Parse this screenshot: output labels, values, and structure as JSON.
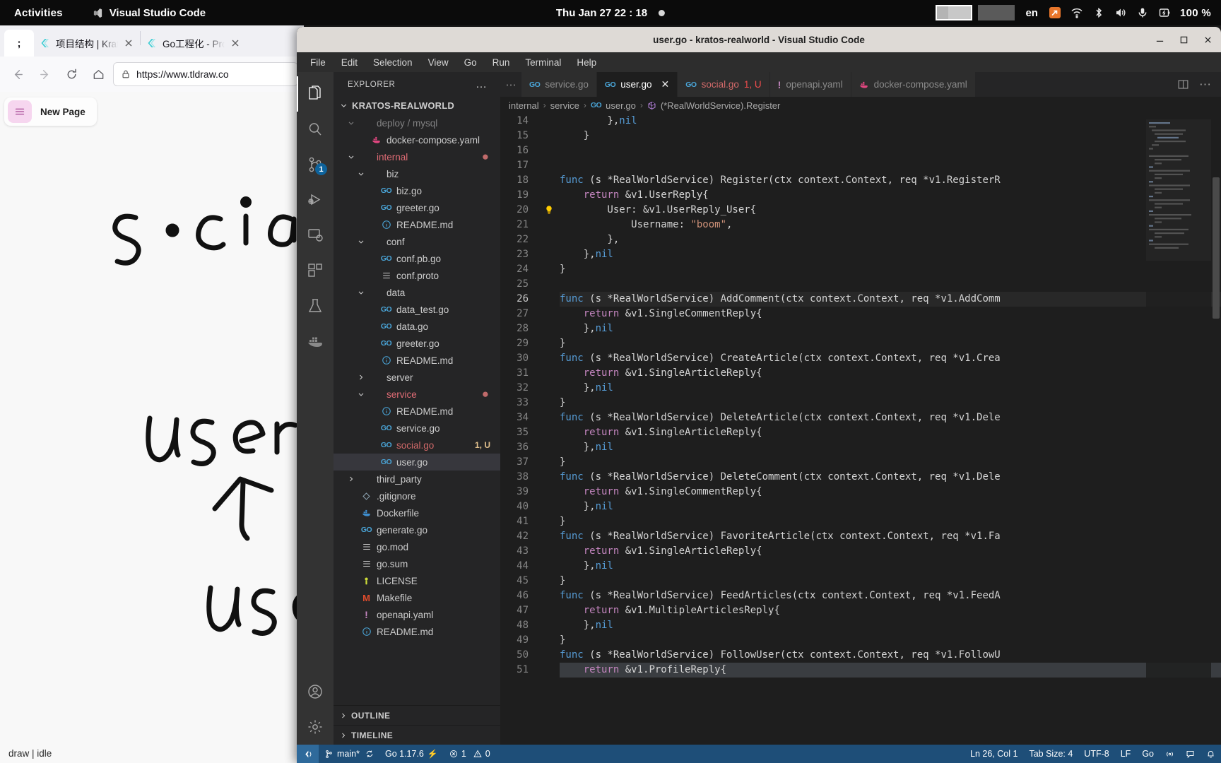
{
  "topbar": {
    "activities": "Activities",
    "app_name": "Visual Studio Code",
    "app_icon": "vscode-icon",
    "clock": "Thu Jan 27  22 : 18",
    "recording_dot": "recording-indicator",
    "language": "en",
    "battery": "100 %",
    "tray_icons": [
      "orange-update-icon",
      "wifi-icon",
      "bluetooth-icon",
      "volume-icon",
      "microphone-icon",
      "battery-icon"
    ]
  },
  "firefox": {
    "pinned_tab_label": ";",
    "tabs": [
      {
        "title": "项目结构 | Krato",
        "favicon": "kratos-icon"
      },
      {
        "title": "Go工程化 - Proje",
        "favicon": "kratos-icon"
      }
    ],
    "nav": {
      "back": "back-arrow",
      "forward": "forward-arrow",
      "reload": "reload-icon",
      "home": "home-icon",
      "lock": "lock-icon",
      "url": "https://www.tldraw.co"
    },
    "tldraw": {
      "menu_icon": "hamburger-menu-icon",
      "page_name": "New Page",
      "sketch_words": [
        "social",
        "user",
        "use"
      ],
      "status": "draw | idle"
    }
  },
  "vscode": {
    "window_title": "user.go - kratos-realworld - Visual Studio Code",
    "window_controls": [
      "minimize",
      "maximize",
      "close"
    ],
    "menus": [
      "File",
      "Edit",
      "Selection",
      "View",
      "Go",
      "Run",
      "Terminal",
      "Help"
    ],
    "activitybar": [
      {
        "name": "explorer",
        "icon": "files-icon",
        "active": true,
        "badge": ""
      },
      {
        "name": "search",
        "icon": "search-icon",
        "active": false,
        "badge": ""
      },
      {
        "name": "source-control",
        "icon": "source-control-icon",
        "active": false,
        "badge": "1"
      },
      {
        "name": "run-and-debug",
        "icon": "debug-icon",
        "active": false,
        "badge": ""
      },
      {
        "name": "remote-explorer",
        "icon": "remote-explorer-icon",
        "active": false,
        "badge": ""
      },
      {
        "name": "extensions",
        "icon": "extensions-icon",
        "active": false,
        "badge": ""
      },
      {
        "name": "testing",
        "icon": "beaker-icon",
        "active": false,
        "badge": ""
      },
      {
        "name": "docker",
        "icon": "docker-icon",
        "active": false,
        "badge": ""
      },
      {
        "name": "accounts",
        "icon": "account-icon",
        "active": false,
        "badge": ""
      },
      {
        "name": "settings",
        "icon": "gear-icon",
        "active": false,
        "badge": ""
      }
    ],
    "explorer": {
      "title": "EXPLORER",
      "more_actions": "…",
      "root": "KRATOS-REALWORLD",
      "tree": [
        {
          "label": "deploy / mysql",
          "indent": 1,
          "kind": "folder",
          "open": true,
          "icon": "",
          "clipped": true
        },
        {
          "label": "docker-compose.yaml",
          "indent": 2,
          "kind": "file",
          "icon": "docker-icon"
        },
        {
          "label": "internal",
          "indent": 1,
          "kind": "folder",
          "open": true,
          "icon": "",
          "color": "mod",
          "dot": "●"
        },
        {
          "label": "biz",
          "indent": 2,
          "kind": "folder",
          "open": true,
          "icon": ""
        },
        {
          "label": "biz.go",
          "indent": 3,
          "kind": "file",
          "icon": "go-icon"
        },
        {
          "label": "greeter.go",
          "indent": 3,
          "kind": "file",
          "icon": "go-icon"
        },
        {
          "label": "README.md",
          "indent": 3,
          "kind": "file",
          "icon": "info-icon"
        },
        {
          "label": "conf",
          "indent": 2,
          "kind": "folder",
          "open": true,
          "icon": ""
        },
        {
          "label": "conf.pb.go",
          "indent": 3,
          "kind": "file",
          "icon": "go-icon"
        },
        {
          "label": "conf.proto",
          "indent": 3,
          "kind": "file",
          "icon": "proto-icon"
        },
        {
          "label": "data",
          "indent": 2,
          "kind": "folder",
          "open": true,
          "icon": ""
        },
        {
          "label": "data_test.go",
          "indent": 3,
          "kind": "file",
          "icon": "go-icon"
        },
        {
          "label": "data.go",
          "indent": 3,
          "kind": "file",
          "icon": "go-icon"
        },
        {
          "label": "greeter.go",
          "indent": 3,
          "kind": "file",
          "icon": "go-icon"
        },
        {
          "label": "README.md",
          "indent": 3,
          "kind": "file",
          "icon": "info-icon"
        },
        {
          "label": "server",
          "indent": 2,
          "kind": "folder",
          "open": false,
          "icon": ""
        },
        {
          "label": "service",
          "indent": 2,
          "kind": "folder",
          "open": true,
          "icon": "",
          "color": "mod",
          "dot": "●"
        },
        {
          "label": "README.md",
          "indent": 3,
          "kind": "file",
          "icon": "info-icon"
        },
        {
          "label": "service.go",
          "indent": 3,
          "kind": "file",
          "icon": "go-icon"
        },
        {
          "label": "social.go",
          "indent": 3,
          "kind": "file",
          "icon": "go-icon",
          "color": "mod2",
          "badge": "1, U"
        },
        {
          "label": "user.go",
          "indent": 3,
          "kind": "file",
          "icon": "go-icon",
          "selected": true
        },
        {
          "label": "third_party",
          "indent": 1,
          "kind": "folder",
          "open": false,
          "icon": ""
        },
        {
          "label": ".gitignore",
          "indent": 1,
          "kind": "file",
          "icon": "git-icon"
        },
        {
          "label": "Dockerfile",
          "indent": 1,
          "kind": "file",
          "icon": "docker-blue-icon"
        },
        {
          "label": "generate.go",
          "indent": 1,
          "kind": "file",
          "icon": "go-icon"
        },
        {
          "label": "go.mod",
          "indent": 1,
          "kind": "file",
          "icon": "proto-icon"
        },
        {
          "label": "go.sum",
          "indent": 1,
          "kind": "file",
          "icon": "proto-icon"
        },
        {
          "label": "LICENSE",
          "indent": 1,
          "kind": "file",
          "icon": "license-icon"
        },
        {
          "label": "Makefile",
          "indent": 1,
          "kind": "file",
          "icon": "makefile-icon"
        },
        {
          "label": "openapi.yaml",
          "indent": 1,
          "kind": "file",
          "icon": "yaml-icon"
        },
        {
          "label": "README.md",
          "indent": 1,
          "kind": "file",
          "icon": "info-icon"
        }
      ],
      "panels": [
        "OUTLINE",
        "TIMELINE"
      ]
    },
    "editor_tabs": [
      {
        "label": "service.go",
        "icon": "go-icon",
        "active": false,
        "badge": ""
      },
      {
        "label": "user.go",
        "icon": "go-icon",
        "active": true,
        "badge": "",
        "closeable": true
      },
      {
        "label": "social.go",
        "icon": "go-icon",
        "active": false,
        "badge": "1, U",
        "error": true
      },
      {
        "label": "openapi.yaml",
        "icon": "yaml-icon",
        "active": false,
        "badge": ""
      },
      {
        "label": "docker-compose.yaml",
        "icon": "docker-icon",
        "active": false,
        "badge": ""
      }
    ],
    "editor_actions": [
      "split-editor-icon",
      "more-actions-icon"
    ],
    "breadcrumb": [
      {
        "label": "internal",
        "icon": ""
      },
      {
        "label": "service",
        "icon": ""
      },
      {
        "label": "user.go",
        "icon": "go-icon"
      },
      {
        "label": "(*RealWorldService).Register",
        "icon": "struct-icon"
      }
    ],
    "code": {
      "first_line": 14,
      "lines": [
        {
          "n": 14,
          "text": "\t\t},nil"
        },
        {
          "n": 15,
          "text": "\t}"
        },
        {
          "n": 16,
          "text": ""
        },
        {
          "n": 17,
          "text": ""
        },
        {
          "n": 18,
          "text": "func (s *RealWorldService) Register(ctx context.Context, req *v1.RegisterR"
        },
        {
          "n": 19,
          "text": "\treturn &v1.UserReply{"
        },
        {
          "n": 20,
          "text": "\t\tUser: &v1.UserReply_User{",
          "lightbulb": true
        },
        {
          "n": 21,
          "text": "\t\t\tUsername: \"boom\","
        },
        {
          "n": 22,
          "text": "\t\t},"
        },
        {
          "n": 23,
          "text": "\t},nil"
        },
        {
          "n": 24,
          "text": "}"
        },
        {
          "n": 25,
          "text": ""
        },
        {
          "n": 26,
          "text": "func (s *RealWorldService) AddComment(ctx context.Context, req *v1.AddComm",
          "highlight": true
        },
        {
          "n": 27,
          "text": "\treturn &v1.SingleCommentReply{"
        },
        {
          "n": 28,
          "text": "\t},nil"
        },
        {
          "n": 29,
          "text": "}"
        },
        {
          "n": 30,
          "text": "func (s *RealWorldService) CreateArticle(ctx context.Context, req *v1.Crea"
        },
        {
          "n": 31,
          "text": "\treturn &v1.SingleArticleReply{"
        },
        {
          "n": 32,
          "text": "\t},nil"
        },
        {
          "n": 33,
          "text": "}"
        },
        {
          "n": 34,
          "text": "func (s *RealWorldService) DeleteArticle(ctx context.Context, req *v1.Dele"
        },
        {
          "n": 35,
          "text": "\treturn &v1.SingleArticleReply{"
        },
        {
          "n": 36,
          "text": "\t},nil"
        },
        {
          "n": 37,
          "text": "}"
        },
        {
          "n": 38,
          "text": "func (s *RealWorldService) DeleteComment(ctx context.Context, req *v1.Dele"
        },
        {
          "n": 39,
          "text": "\treturn &v1.SingleCommentReply{"
        },
        {
          "n": 40,
          "text": "\t},nil"
        },
        {
          "n": 41,
          "text": "}"
        },
        {
          "n": 42,
          "text": "func (s *RealWorldService) FavoriteArticle(ctx context.Context, req *v1.Fa"
        },
        {
          "n": 43,
          "text": "\treturn &v1.SingleArticleReply{"
        },
        {
          "n": 44,
          "text": "\t},nil"
        },
        {
          "n": 45,
          "text": "}"
        },
        {
          "n": 46,
          "text": "func (s *RealWorldService) FeedArticles(ctx context.Context, req *v1.FeedA"
        },
        {
          "n": 47,
          "text": "\treturn &v1.MultipleArticlesReply{"
        },
        {
          "n": 48,
          "text": "\t},nil"
        },
        {
          "n": 49,
          "text": "}"
        },
        {
          "n": 50,
          "text": "func (s *RealWorldService) FollowUser(ctx context.Context, req *v1.FollowU"
        },
        {
          "n": 51,
          "text": "\treturn &v1.ProfileReply{",
          "selected": true
        }
      ]
    },
    "statusbar": {
      "remote_icon": "remote-window-icon",
      "branch_icon": "source-control-branch-icon",
      "branch": "main*",
      "sync_icon": "sync-icon",
      "go_version": "Go 1.17.6",
      "go_build_icon": "build-icon",
      "errors_icon": "error-icon",
      "errors": "1",
      "warnings_icon": "warning-icon",
      "warnings": "0",
      "cursor": "Ln 26, Col 1",
      "tab_size": "Tab Size: 4",
      "encoding": "UTF-8",
      "eol": "LF",
      "language": "Go",
      "bell_icon": "bell-icon",
      "feedback_icon": "feedback-icon",
      "broadcast_icon": "broadcast-icon"
    }
  }
}
